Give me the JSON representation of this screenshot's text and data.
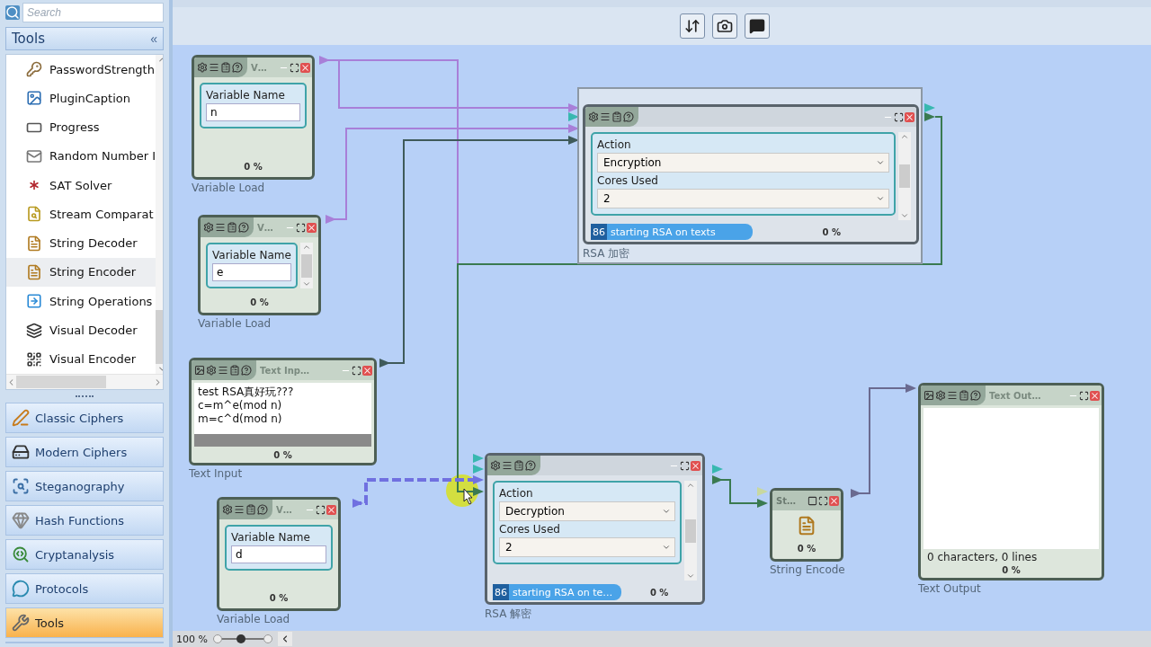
{
  "search": {
    "placeholder": "Search"
  },
  "tools_panel": {
    "title": "Tools",
    "collapse": "«"
  },
  "tool_items": [
    {
      "label": "PasswordStrength",
      "selected": false
    },
    {
      "label": "PluginCaption",
      "selected": false
    },
    {
      "label": "Progress",
      "selected": false
    },
    {
      "label": "Random Number I",
      "selected": false
    },
    {
      "label": "SAT Solver",
      "selected": false
    },
    {
      "label": "Stream Comparat",
      "selected": false
    },
    {
      "label": "String Decoder",
      "selected": false
    },
    {
      "label": "String Encoder",
      "selected": true
    },
    {
      "label": "String Operations",
      "selected": false
    },
    {
      "label": "Visual Decoder",
      "selected": false
    },
    {
      "label": "Visual Encoder",
      "selected": false
    }
  ],
  "categories": [
    {
      "label": "Classic Ciphers",
      "selected": false
    },
    {
      "label": "Modern Ciphers",
      "selected": false
    },
    {
      "label": "Steganography",
      "selected": false
    },
    {
      "label": "Hash Functions",
      "selected": false
    },
    {
      "label": "Cryptanalysis",
      "selected": false
    },
    {
      "label": "Protocols",
      "selected": false
    },
    {
      "label": "Tools",
      "selected": true
    }
  ],
  "nodes": [
    {
      "kind": "variable_load",
      "selected": false,
      "scrollable": false,
      "title": "V…",
      "field_label": "Variable Name",
      "value": "n",
      "progress": "0 %",
      "caption": "Variable Load"
    },
    {
      "kind": "variable_load",
      "selected": false,
      "scrollable": true,
      "title": "V…",
      "field_label": "Variable Name",
      "value": "e",
      "progress": "0 %",
      "caption": "Variable Load"
    },
    {
      "kind": "rsa",
      "selected": true,
      "action_label": "Action",
      "action": "Encryption",
      "cores_label": "Cores Used",
      "cores": "2",
      "status_code": "86",
      "status": "starting RSA on texts",
      "progress": "0 %",
      "caption": "RSA 加密"
    },
    {
      "kind": "text_input",
      "selected": false,
      "title": "Text Inp…",
      "lines": [
        "test RSA真好玩???",
        "c=m^e(mod n)",
        "m=c^d(mod n)"
      ],
      "progress": "0 %",
      "caption": "Text Input"
    },
    {
      "kind": "variable_load",
      "selected": false,
      "scrollable": false,
      "title": "V…",
      "field_label": "Variable Name",
      "value": "d",
      "progress": "0 %",
      "caption": "Variable Load"
    },
    {
      "kind": "rsa",
      "selected": false,
      "action_label": "Action",
      "action": "Decryption",
      "cores_label": "Cores Used",
      "cores": "2",
      "status_code": "86",
      "status": "starting RSA on te…",
      "progress": "0 %",
      "caption": "RSA 解密"
    },
    {
      "kind": "string_encoder",
      "selected": false,
      "title": "St…",
      "progress": "0 %",
      "caption": "String Encode"
    },
    {
      "kind": "text_output",
      "selected": false,
      "title": "Text Out…",
      "status": "0 characters,  0 lines",
      "progress": "0 %",
      "caption": "Text Output"
    }
  ],
  "zoom": {
    "label": "100 %",
    "level": 0.45
  }
}
